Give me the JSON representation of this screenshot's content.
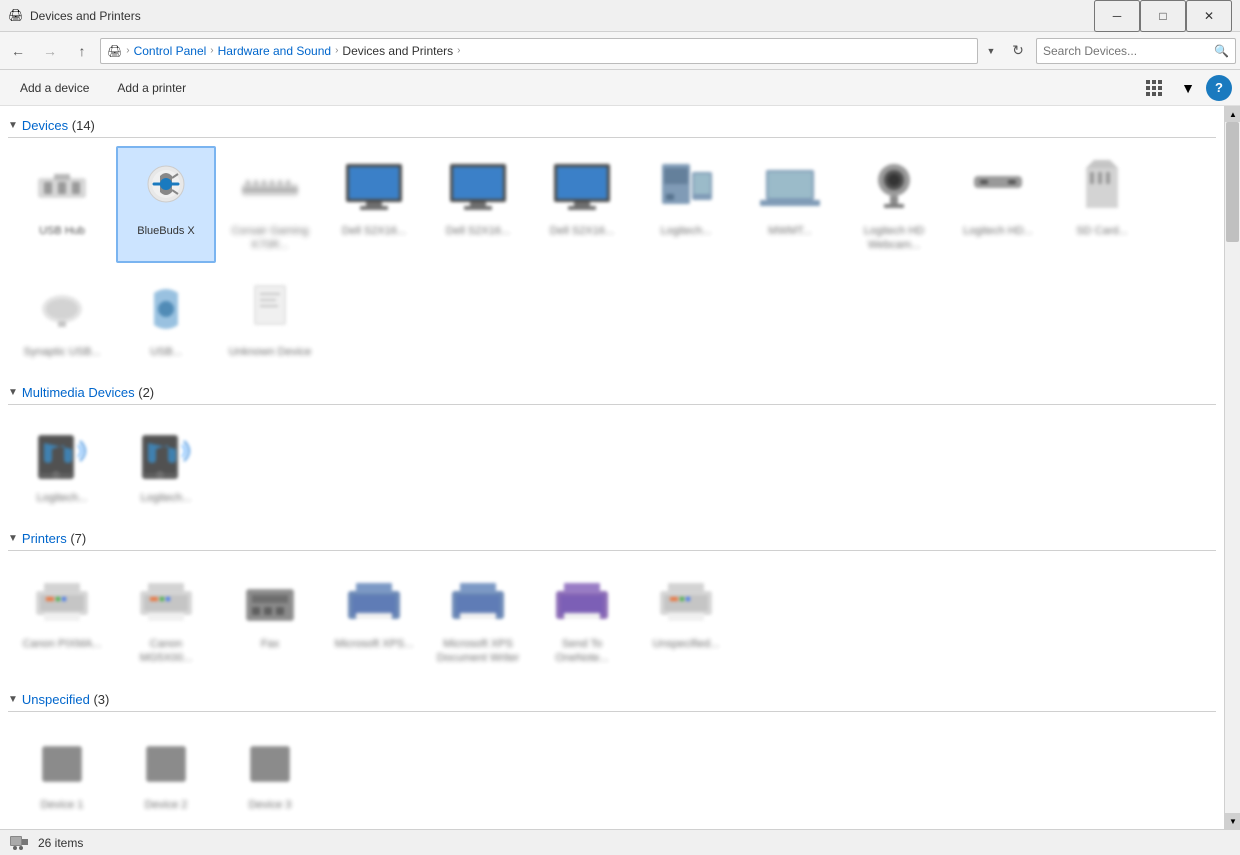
{
  "window": {
    "title": "Devices and Printers",
    "icon": "🖨"
  },
  "titlebar": {
    "minimize_label": "─",
    "maximize_label": "□",
    "close_label": "✕"
  },
  "addressbar": {
    "back_label": "←",
    "forward_label": "→",
    "up_label": "↑",
    "breadcrumb": {
      "icon": "🖨",
      "items": [
        "Control Panel",
        "Hardware and Sound",
        "Devices and Printers"
      ],
      "separator": "›"
    },
    "refresh_label": "↻",
    "search_placeholder": "Search Devices..."
  },
  "toolbar": {
    "add_device_label": "Add a device",
    "add_printer_label": "Add a printer",
    "help_label": "?"
  },
  "sections": {
    "devices": {
      "label": "Devices",
      "count": "(14)",
      "items": [
        {
          "name": "USB Hub",
          "selected": false
        },
        {
          "name": "BlueBuds X",
          "selected": true
        },
        {
          "name": "Corsair Gaming K70R...",
          "selected": false
        },
        {
          "name": "Dell S2X16...",
          "selected": false
        },
        {
          "name": "Dell S2X16...",
          "selected": false
        },
        {
          "name": "Dell S2X16...",
          "selected": false
        },
        {
          "name": "Logitech...",
          "selected": false
        },
        {
          "name": "MWMT...",
          "selected": false
        },
        {
          "name": "Logitech HD Webcam...",
          "selected": false
        },
        {
          "name": "Logitech HD...",
          "selected": false
        },
        {
          "name": "SD Card...",
          "selected": false
        },
        {
          "name": "Synaptic USB...",
          "selected": false
        },
        {
          "name": "USB...",
          "selected": false
        },
        {
          "name": "Unknown Device",
          "selected": false
        }
      ]
    },
    "multimedia": {
      "label": "Multimedia Devices",
      "count": "(2)",
      "items": [
        {
          "name": "Logitech...",
          "selected": false
        },
        {
          "name": "Logitech...",
          "selected": false
        }
      ]
    },
    "printers": {
      "label": "Printers",
      "count": "(7)",
      "items": [
        {
          "name": "Canon PIXMA...",
          "selected": false
        },
        {
          "name": "Canon MG5X00...",
          "selected": false
        },
        {
          "name": "Fax",
          "selected": false
        },
        {
          "name": "Microsoft XPS...",
          "selected": false
        },
        {
          "name": "Microsoft XPS Document Writer",
          "selected": false
        },
        {
          "name": "Send To OneNote...",
          "selected": false
        },
        {
          "name": "Unspecified...",
          "selected": false
        }
      ]
    },
    "unspecified": {
      "label": "Unspecified",
      "count": "(3)",
      "items": [
        {
          "name": "Device 1",
          "selected": false
        },
        {
          "name": "Device 2",
          "selected": false
        },
        {
          "name": "Device 3",
          "selected": false
        }
      ]
    }
  },
  "statusbar": {
    "item_count": "26 items"
  }
}
